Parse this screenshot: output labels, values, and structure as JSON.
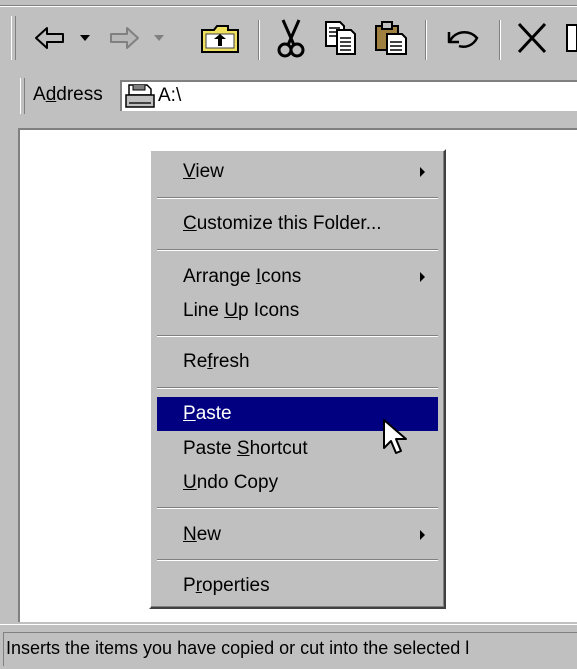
{
  "address": {
    "label": "Address",
    "value": "A:\\",
    "drive_icon": "floppy-drive-icon"
  },
  "toolbar": {
    "buttons": [
      {
        "name": "back",
        "icon": "back-arrow-icon"
      },
      {
        "name": "back-dropdown",
        "icon": "dropdown-icon"
      },
      {
        "name": "forward",
        "icon": "forward-arrow-icon"
      },
      {
        "name": "forward-dropdown",
        "icon": "dropdown-icon"
      },
      {
        "name": "up",
        "icon": "up-folder-icon"
      },
      {
        "name": "cut",
        "icon": "scissors-icon"
      },
      {
        "name": "copy",
        "icon": "copy-icon"
      },
      {
        "name": "paste",
        "icon": "paste-icon"
      },
      {
        "name": "undo",
        "icon": "undo-icon"
      },
      {
        "name": "delete",
        "icon": "delete-x-icon"
      }
    ]
  },
  "context_menu": {
    "items": [
      {
        "key": "view",
        "label": "View",
        "mnemonic": "V",
        "submenu": true
      },
      {
        "key": "customize",
        "label": "Customize this Folder...",
        "mnemonic": "C"
      },
      {
        "key": "arrange_icons",
        "label": "Arrange Icons",
        "mnemonic": "I",
        "submenu": true
      },
      {
        "key": "line_up_icons",
        "label": "Line Up Icons",
        "mnemonic": "U"
      },
      {
        "key": "refresh",
        "label": "Refresh",
        "mnemonic": "f"
      },
      {
        "key": "paste",
        "label": "Paste",
        "mnemonic": "P",
        "highlighted": true
      },
      {
        "key": "paste_shortcut",
        "label": "Paste Shortcut",
        "mnemonic": "S"
      },
      {
        "key": "undo_copy",
        "label": "Undo Copy",
        "mnemonic": "U"
      },
      {
        "key": "new",
        "label": "New",
        "mnemonic": "N",
        "submenu": true
      },
      {
        "key": "properties",
        "label": "Properties",
        "mnemonic": "r"
      }
    ]
  },
  "status_bar": {
    "text": "Inserts the items you have copied or cut into the selected l"
  },
  "colors": {
    "face": "#c0c0c0",
    "highlight": "#000080",
    "highlight_text": "#ffffff",
    "window": "#ffffff"
  }
}
